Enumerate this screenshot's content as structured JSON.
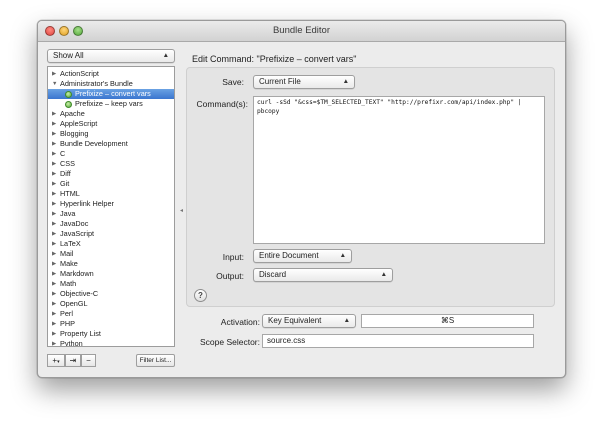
{
  "window": {
    "title": "Bundle Editor"
  },
  "filter_popup": {
    "value": "Show All"
  },
  "bundle_list": [
    {
      "label": "ActionScript",
      "level": 0,
      "expanded": false
    },
    {
      "label": "Administrator's Bundle",
      "level": 0,
      "expanded": true
    },
    {
      "label": "Prefixize – convert vars",
      "level": 1,
      "command": true,
      "selected": true
    },
    {
      "label": "Prefixize – keep vars",
      "level": 1,
      "command": true
    },
    {
      "label": "Apache",
      "level": 0,
      "expanded": false
    },
    {
      "label": "AppleScript",
      "level": 0,
      "expanded": false
    },
    {
      "label": "Blogging",
      "level": 0,
      "expanded": false
    },
    {
      "label": "Bundle Development",
      "level": 0,
      "expanded": false
    },
    {
      "label": "C",
      "level": 0,
      "expanded": false
    },
    {
      "label": "CSS",
      "level": 0,
      "expanded": false
    },
    {
      "label": "Diff",
      "level": 0,
      "expanded": false
    },
    {
      "label": "Git",
      "level": 0,
      "expanded": false
    },
    {
      "label": "HTML",
      "level": 0,
      "expanded": false
    },
    {
      "label": "Hyperlink Helper",
      "level": 0,
      "expanded": false
    },
    {
      "label": "Java",
      "level": 0,
      "expanded": false
    },
    {
      "label": "JavaDoc",
      "level": 0,
      "expanded": false
    },
    {
      "label": "JavaScript",
      "level": 0,
      "expanded": false
    },
    {
      "label": "LaTeX",
      "level": 0,
      "expanded": false
    },
    {
      "label": "Mail",
      "level": 0,
      "expanded": false
    },
    {
      "label": "Make",
      "level": 0,
      "expanded": false
    },
    {
      "label": "Markdown",
      "level": 0,
      "expanded": false
    },
    {
      "label": "Math",
      "level": 0,
      "expanded": false
    },
    {
      "label": "Objective-C",
      "level": 0,
      "expanded": false
    },
    {
      "label": "OpenGL",
      "level": 0,
      "expanded": false
    },
    {
      "label": "Perl",
      "level": 0,
      "expanded": false
    },
    {
      "label": "PHP",
      "level": 0,
      "expanded": false
    },
    {
      "label": "Property List",
      "level": 0,
      "expanded": false
    },
    {
      "label": "Python",
      "level": 0,
      "expanded": false
    }
  ],
  "bottom_bar": {
    "add_label": "+",
    "add_menu_arrow": "▾",
    "action_label": "⇥",
    "remove_label": "−",
    "filter_label": "Filter List..."
  },
  "editor": {
    "heading": "Edit Command: \"Prefixize – convert vars\"",
    "save_label": "Save:",
    "save_value": "Current File",
    "commands_label": "Command(s):",
    "command_text": "curl -sSd \"&css=$TM_SELECTED_TEXT\" \"http://prefixr.com/api/index.php\" |\npbcopy",
    "input_label": "Input:",
    "input_value": "Entire Document",
    "output_label": "Output:",
    "output_value": "Discard",
    "help_label": "?",
    "activation_label": "Activation:",
    "activation_value": "Key Equivalent",
    "key_equivalent": "⌘S",
    "scope_label": "Scope Selector:",
    "scope_value": "source.css"
  },
  "colors": {
    "selection": "#3b76cf",
    "command_icon": "#57a83b"
  }
}
